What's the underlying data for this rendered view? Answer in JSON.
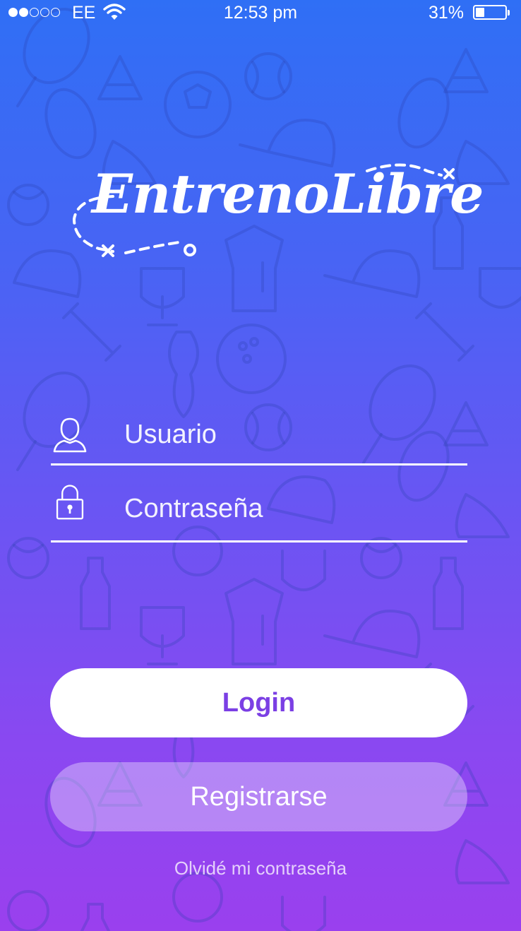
{
  "status_bar": {
    "signal_dots_filled": 2,
    "signal_dots_total": 5,
    "carrier": "EE",
    "time": "12:53 pm",
    "battery_percent": "31%",
    "battery_level": 0.31,
    "wifi_icon": "wifi-icon"
  },
  "brand": {
    "logo_text": "EntrenoLibre"
  },
  "login_form": {
    "username_placeholder": "Usuario",
    "password_placeholder": "Contraseña",
    "username_icon": "user-icon",
    "password_icon": "lock-icon",
    "login_label": "Login",
    "register_label": "Registrarse",
    "forgot_password_label": "Olvidé mi contraseña"
  },
  "colors": {
    "gradient_top": "#2f6ff5",
    "gradient_bottom": "#9a40ee",
    "login_text": "#7b3fe4"
  }
}
